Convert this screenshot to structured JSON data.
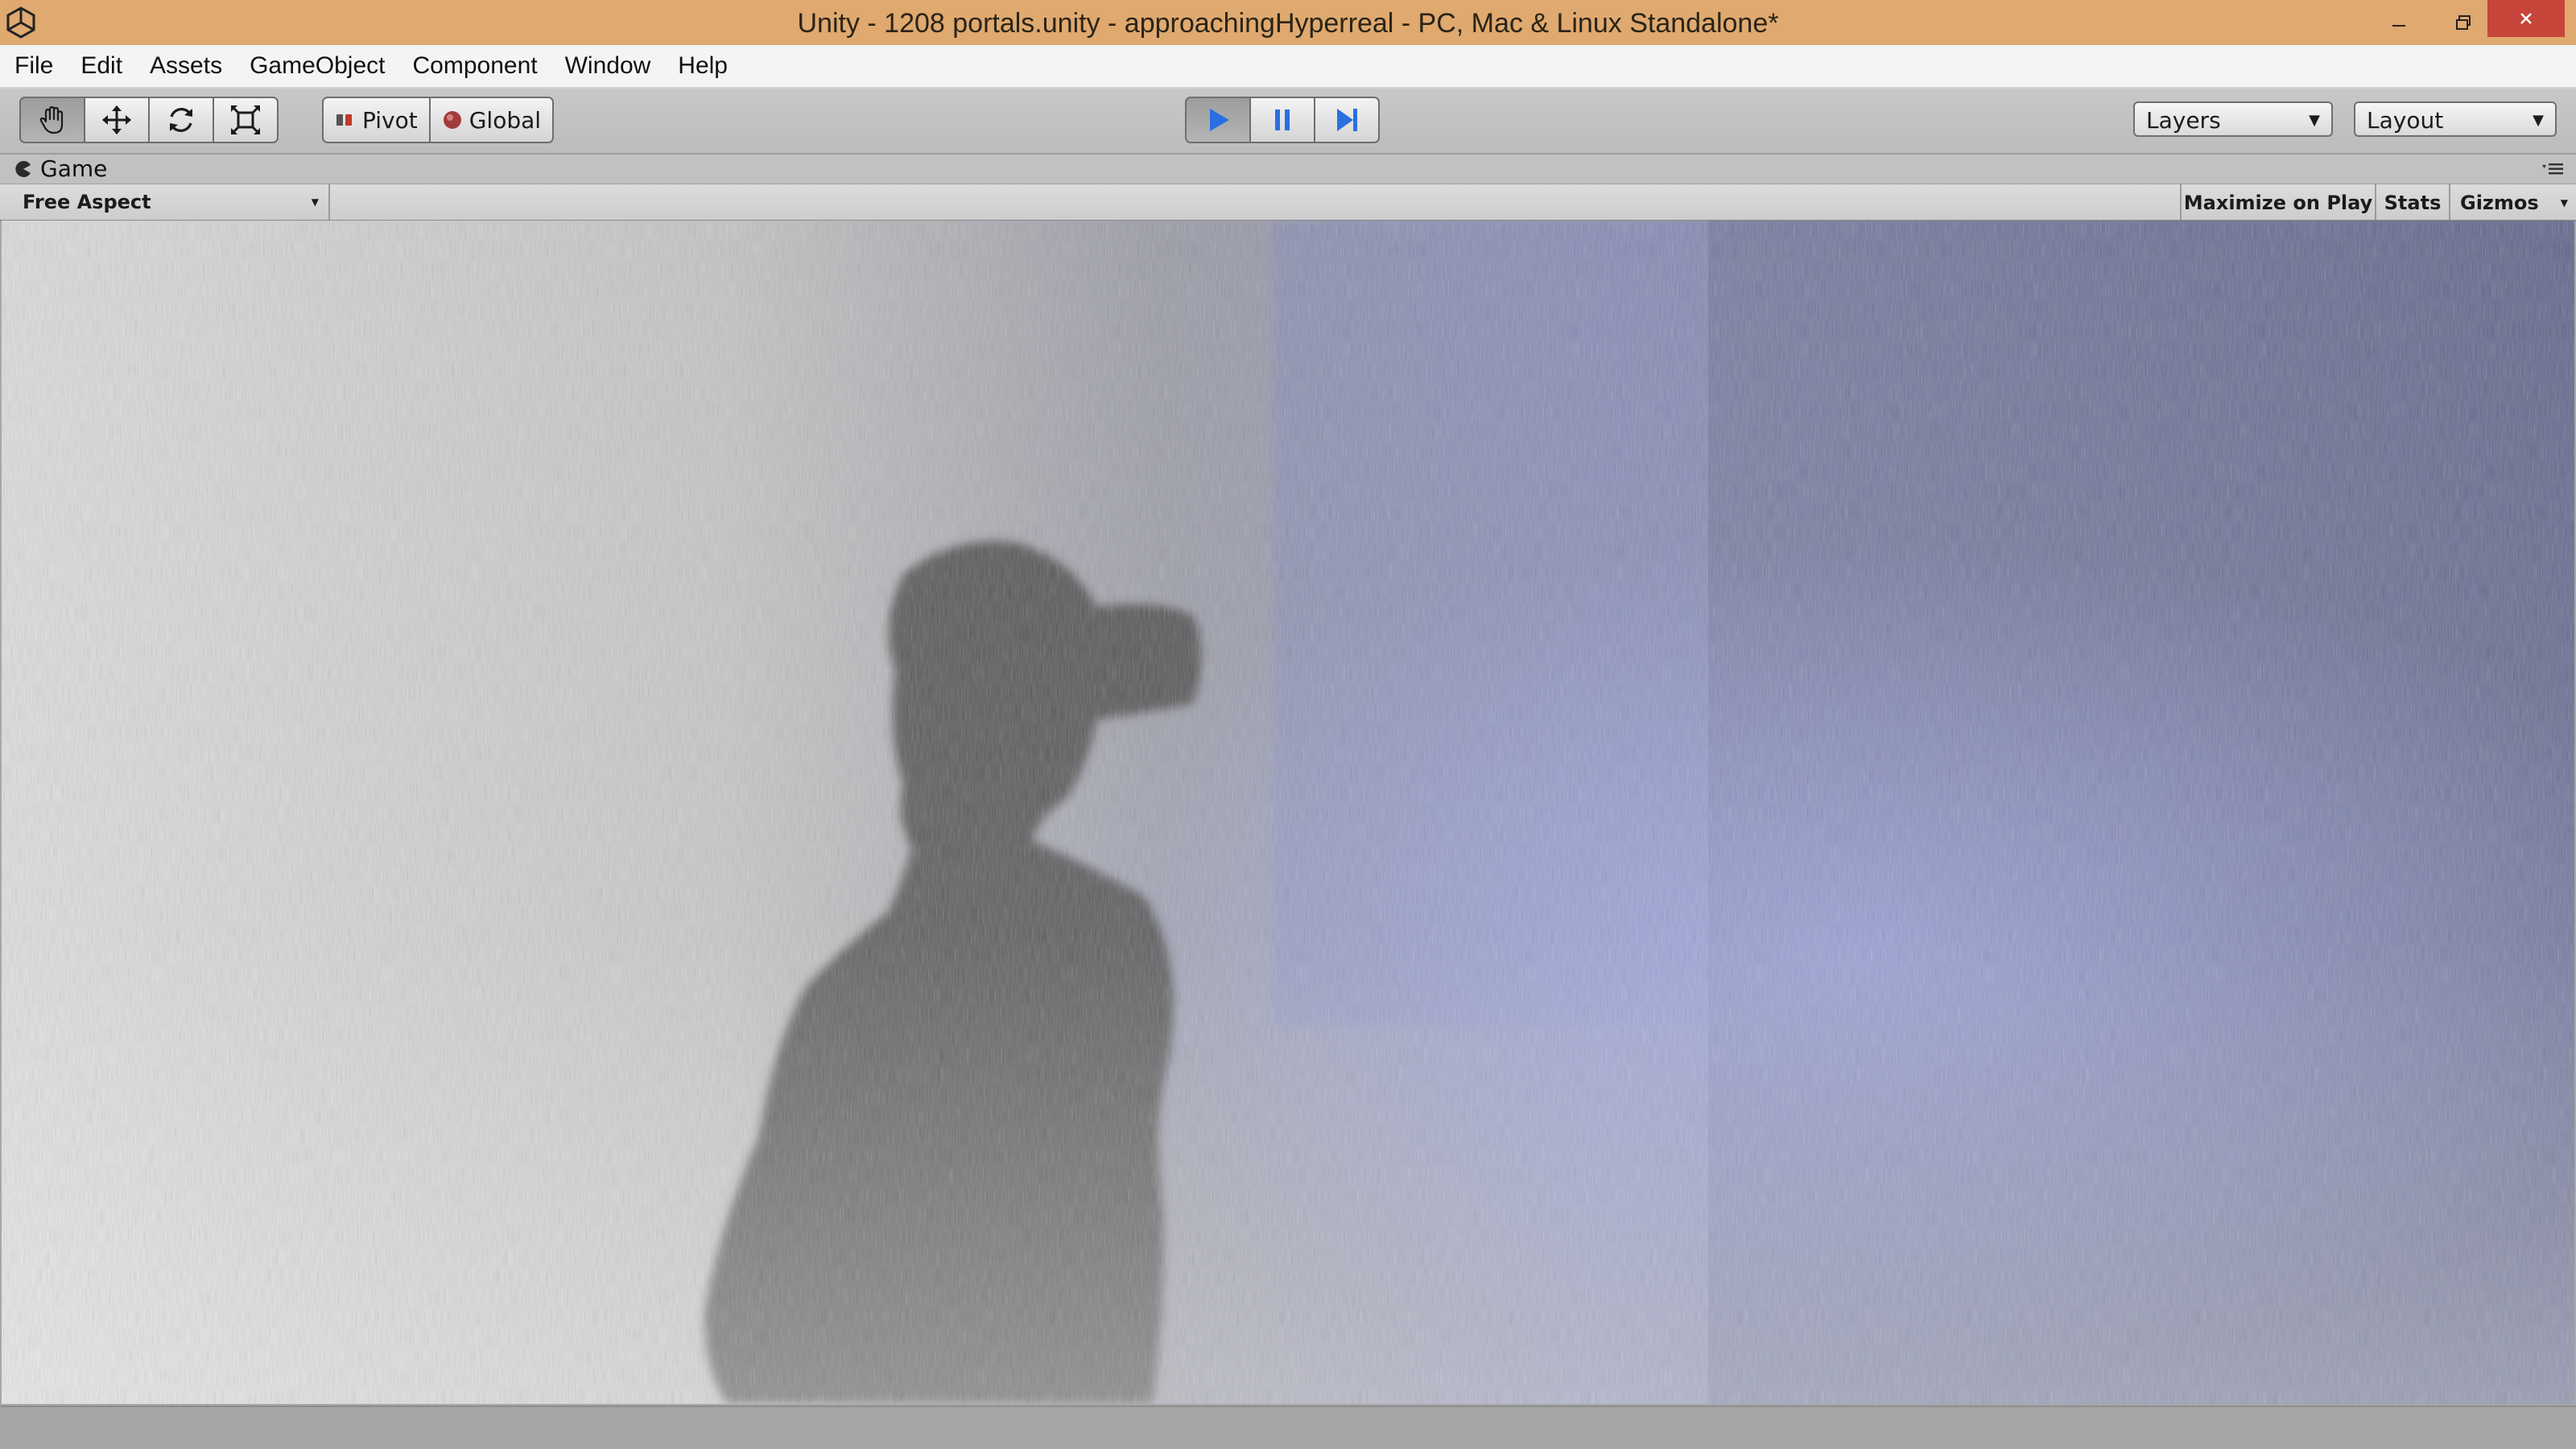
{
  "window": {
    "title": "Unity - 1208 portals.unity - approachingHyperreal - PC, Mac & Linux Standalone*",
    "app_icon": "unity-logo-icon",
    "controls": [
      "minimize-icon",
      "restore-icon",
      "close-icon"
    ]
  },
  "menu": {
    "items": [
      {
        "label": "File"
      },
      {
        "label": "Edit"
      },
      {
        "label": "Assets"
      },
      {
        "label": "GameObject"
      },
      {
        "label": "Component"
      },
      {
        "label": "Window"
      },
      {
        "label": "Help"
      }
    ]
  },
  "toolbar": {
    "transform_tools": [
      {
        "icon": "hand-icon",
        "active": true
      },
      {
        "icon": "move-icon",
        "active": false
      },
      {
        "icon": "rotate-icon",
        "active": false
      },
      {
        "icon": "scale-icon",
        "active": false
      }
    ],
    "pivot_label": "Pivot",
    "global_label": "Global",
    "play": {
      "icon": "play-icon",
      "active": true
    },
    "pause": {
      "icon": "pause-icon",
      "active": false
    },
    "step": {
      "icon": "step-icon",
      "active": false
    },
    "layers_label": "Layers",
    "layout_label": "Layout"
  },
  "game_panel": {
    "tab_label": "Game",
    "aspect_label": "Free Aspect",
    "maximize_label": "Maximize on Play",
    "stats_label": "Stats",
    "gizmos_label": "Gizmos"
  },
  "colors": {
    "titlebar": "#dfa96f",
    "close_button": "#c7453a",
    "play_blue": "#2a6fe0"
  }
}
